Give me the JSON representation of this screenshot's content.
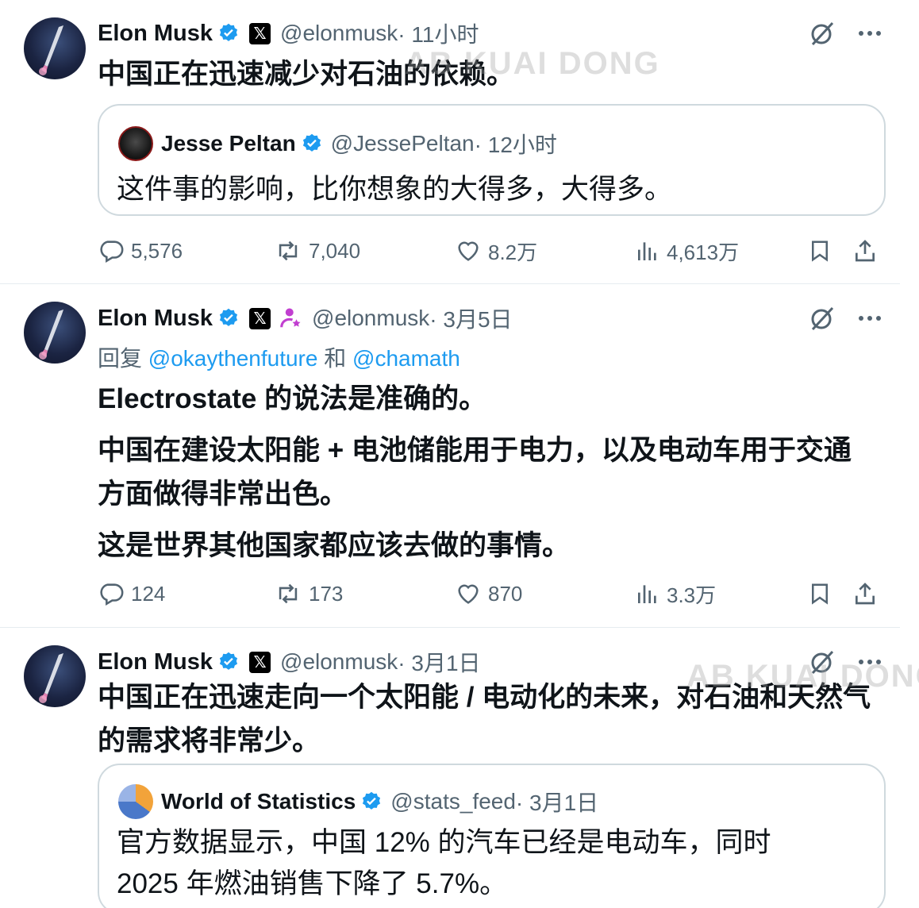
{
  "tweets": [
    {
      "author": {
        "name": "Elon Musk",
        "handle": "@elonmusk",
        "verified": true,
        "affiliate_icon": "x-logo-icon"
      },
      "time": " · 11小时",
      "text": "中国正在迅速减少对石油的依赖。",
      "quote": {
        "author": {
          "name": "Jesse Peltan",
          "handle": "@JessePeltan",
          "verified": true
        },
        "time": " · 12小时",
        "text": "这件事的影响，比你想象的大得多，大得多。"
      },
      "stats": {
        "replies": "5,576",
        "reposts": "7,040",
        "likes": "8.2万",
        "views": "4,613万"
      }
    },
    {
      "author": {
        "name": "Elon Musk",
        "handle": "@elonmusk",
        "verified": true,
        "affiliate_icon": "x-logo-icon",
        "extra_badge": "person-star-icon"
      },
      "time": " · 3月5日",
      "reply_to": {
        "prefix": "回复 ",
        "user1": "@okaythenfuture",
        "joiner": " 和 ",
        "user2": "@chamath"
      },
      "paragraphs": [
        "Electrostate 的说法是准确的。",
        "中国在建设太阳能 + 电池储能用于电力，以及电动车用于交通方面做得非常出色。",
        "这是世界其他国家都应该去做的事情。"
      ],
      "stats": {
        "replies": "124",
        "reposts": "173",
        "likes": "870",
        "views": "3.3万"
      }
    },
    {
      "author": {
        "name": "Elon Musk",
        "handle": "@elonmusk",
        "verified": true,
        "affiliate_icon": "x-logo-icon"
      },
      "time": " · 3月1日",
      "text": "中国正在迅速走向一个太阳能 / 电动化的未来，对石油和天然气的需求将非常少。",
      "quote": {
        "author": {
          "name": "World of Statistics",
          "handle": "@stats_feed",
          "verified": true
        },
        "time": " · 3月1日",
        "text": "官方数据显示，中国 12% 的汽车已经是电动车，同时 2025 年燃油销售下降了 5.7%。"
      }
    }
  ],
  "watermarks": [
    "AB KUAI DONG",
    "AB KUAI DONG"
  ],
  "colors": {
    "accent": "#1d9bf0",
    "muted": "#536471",
    "text": "#0f1419",
    "border": "#cfd9de"
  }
}
